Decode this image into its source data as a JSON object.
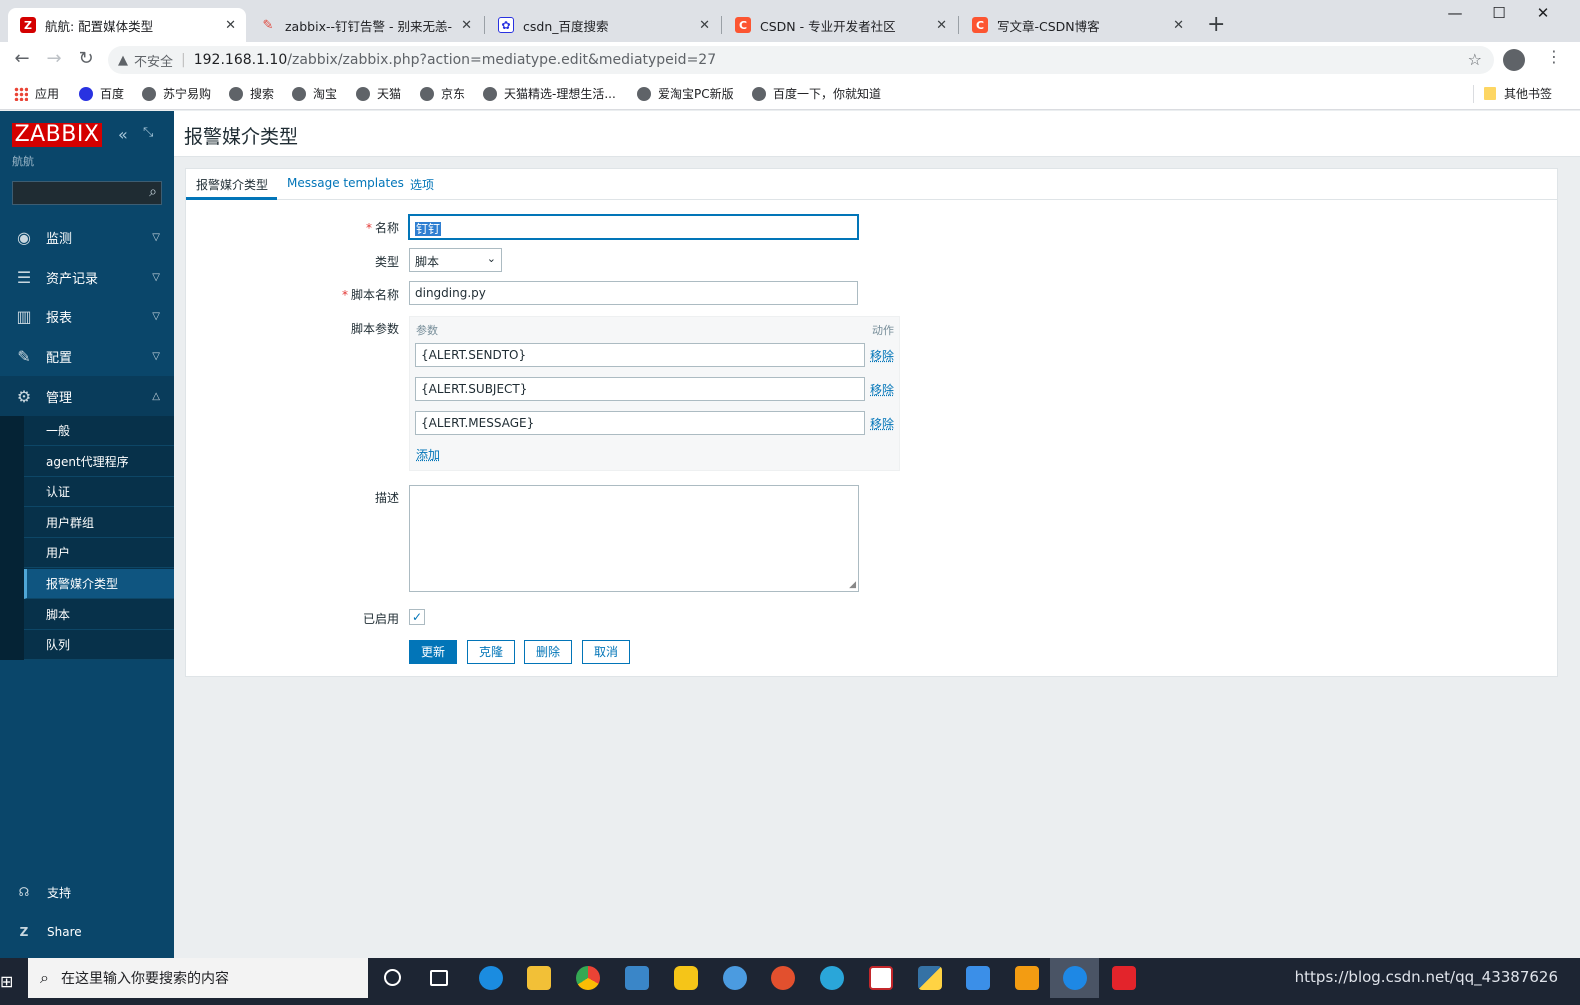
{
  "browser": {
    "tabs": [
      {
        "title": "航航: 配置媒体类型",
        "icon": "zabbix-favicon",
        "color": "#d40000",
        "glyph": "Z"
      },
      {
        "title": "zabbix--钉钉告警 - 别来无恙- -",
        "icon": "feather-favicon",
        "color": "#e0483d",
        "glyph": "✎"
      },
      {
        "title": "csdn_百度搜索",
        "icon": "baidu-paw-favicon",
        "color": "#2932e1",
        "glyph": "✿"
      },
      {
        "title": "CSDN - 专业开发者社区",
        "icon": "csdn-favicon",
        "color": "#fc5531",
        "glyph": "C"
      },
      {
        "title": "写文章-CSDN博客",
        "icon": "csdn-favicon",
        "color": "#fc5531",
        "glyph": "C"
      }
    ],
    "new_tab": "+",
    "window_controls": {
      "minimize": "—",
      "maximize": "☐",
      "close": "✕"
    },
    "address": {
      "security_label": "不安全",
      "url_host": "192.168.1.10",
      "url_path": "/zabbix/zabbix.php?action=mediatype.edit&mediatypeid=27"
    },
    "bookmarks": [
      {
        "label": "应用"
      },
      {
        "label": "百度"
      },
      {
        "label": "苏宁易购"
      },
      {
        "label": "搜索"
      },
      {
        "label": "淘宝"
      },
      {
        "label": "天猫"
      },
      {
        "label": "京东"
      },
      {
        "label": "天猫精选-理想生活..."
      },
      {
        "label": "爱淘宝PC新版"
      },
      {
        "label": "百度一下，你就知道"
      }
    ],
    "other_bookmarks": "其他书签"
  },
  "sidebar": {
    "logo": "ZABBIX",
    "server_name": "航航",
    "menu": [
      {
        "label": "监测",
        "icon": "eye-icon"
      },
      {
        "label": "资产记录",
        "icon": "list-icon"
      },
      {
        "label": "报表",
        "icon": "bar-chart-icon"
      },
      {
        "label": "配置",
        "icon": "wrench-icon"
      },
      {
        "label": "管理",
        "icon": "gear-icon"
      }
    ],
    "admin_submenu": [
      "一般",
      "agent代理程序",
      "认证",
      "用户群组",
      "用户",
      "报警媒介类型",
      "脚本",
      "队列"
    ],
    "footer": [
      {
        "label": "支持",
        "icon": "headset-icon"
      },
      {
        "label": "Share",
        "icon": "share-z-icon"
      }
    ]
  },
  "page": {
    "title": "报警媒介类型",
    "tabs": [
      "报警媒介类型",
      "Message templates",
      "选项"
    ],
    "form": {
      "name_label": "名称",
      "name_value": "钉钉",
      "type_label": "类型",
      "type_value": "脚本",
      "script_name_label": "脚本名称",
      "script_name_value": "dingding.py",
      "script_params_label": "脚本参数",
      "params_col": "参数",
      "action_col": "动作",
      "params": [
        "{ALERT.SENDTO}",
        "{ALERT.SUBJECT}",
        "{ALERT.MESSAGE}"
      ],
      "remove_label": "移除",
      "add_label": "添加",
      "description_label": "描述",
      "description_value": "",
      "enabled_label": "已启用",
      "enabled": true
    },
    "buttons": {
      "update": "更新",
      "clone": "克隆",
      "delete": "删除",
      "cancel": "取消"
    }
  },
  "taskbar": {
    "search_placeholder": "在这里输入你要搜索的内容",
    "status_url": "https://blog.csdn.net/qq_43387626",
    "apps": [
      "task-view-icon",
      "edge-icon",
      "file-explorer-icon",
      "chrome-icon",
      "remote-desktop-icon",
      "app-g-icon",
      "kite-icon",
      "snail-icon",
      "edge-dev-icon",
      "vs-code-icon",
      "python-icon",
      "feishu-icon",
      "vmware-icon",
      "dingtalk-icon",
      "youdao-icon"
    ]
  },
  "colors": {
    "sidebar_bg": "#0a466a",
    "zabbix_red": "#d40000",
    "link_blue": "#0275b8",
    "required_red": "#e33734"
  }
}
